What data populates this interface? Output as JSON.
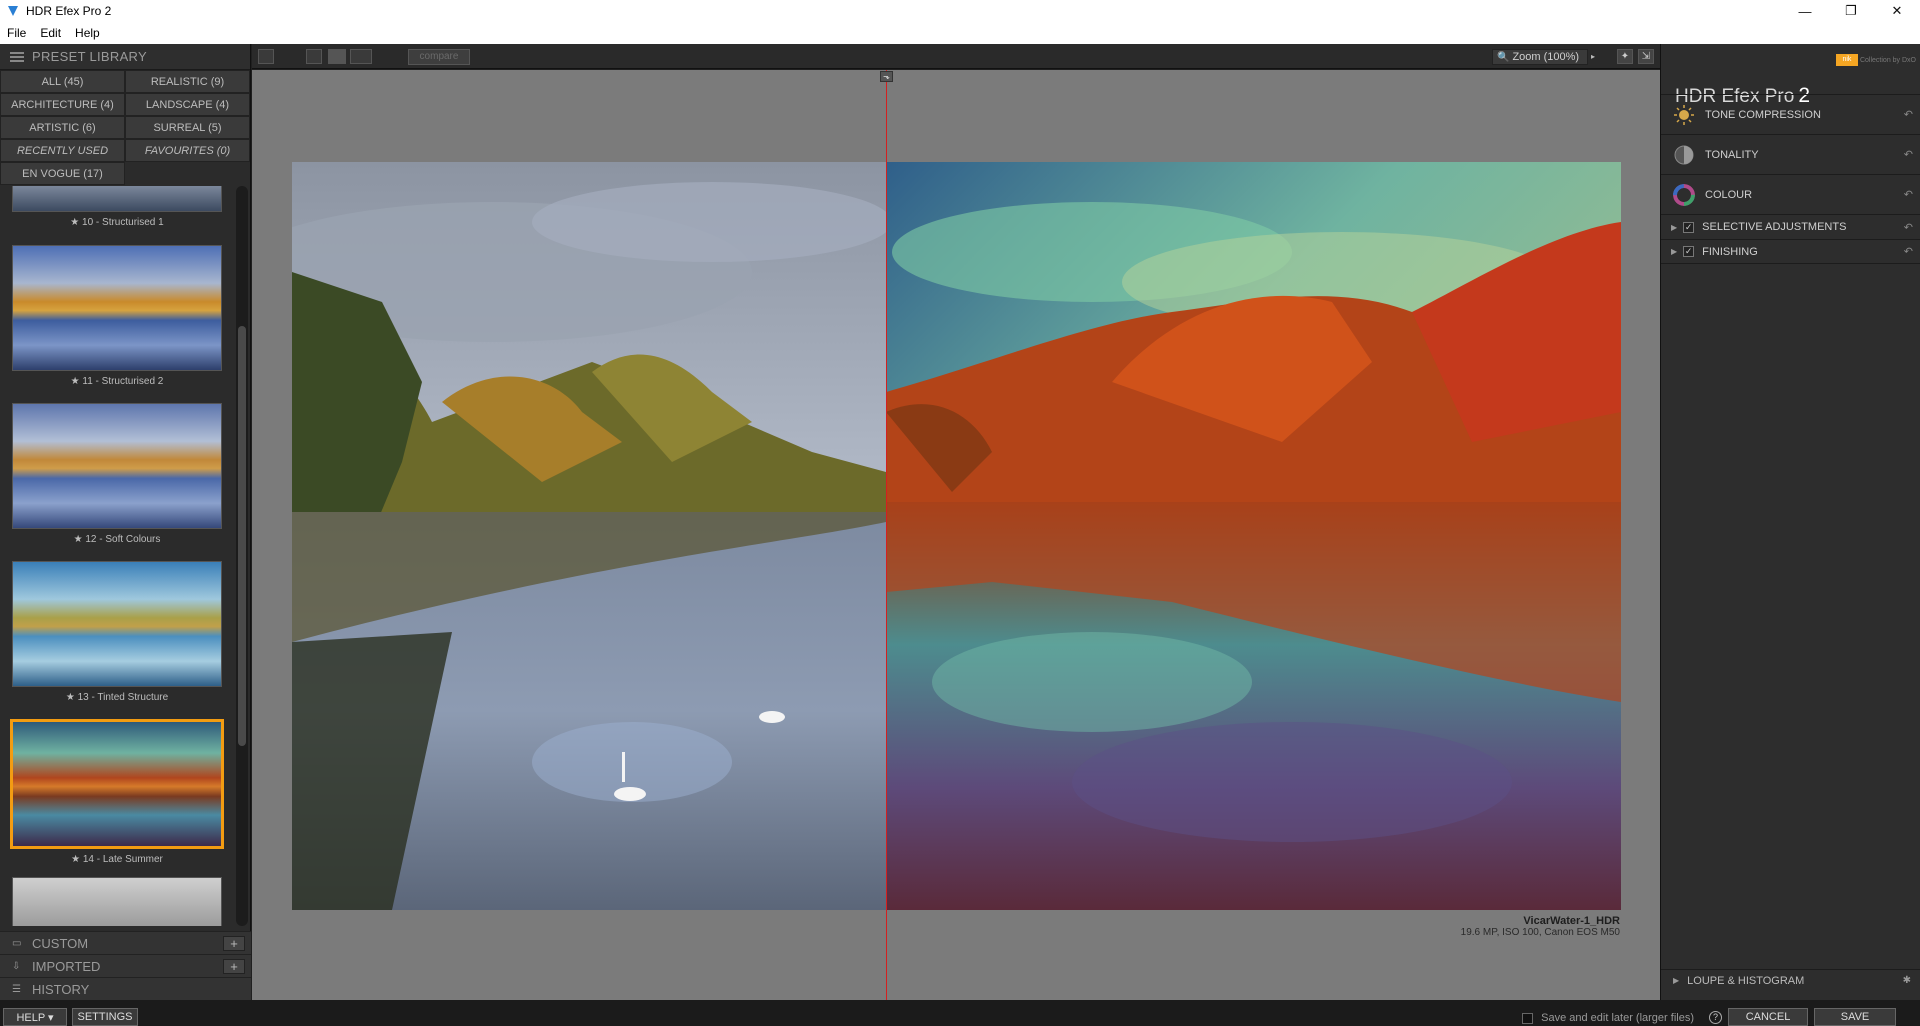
{
  "window": {
    "title": "HDR Efex Pro 2",
    "controls": [
      "—",
      "❐",
      "✕"
    ]
  },
  "menu": [
    "File",
    "Edit",
    "Help"
  ],
  "preset_library": {
    "header": "PRESET LIBRARY",
    "categories": [
      "ALL (45)",
      "REALISTIC (9)",
      "ARCHITECTURE (4)",
      "LANDSCAPE (4)",
      "ARTISTIC (6)",
      "SURREAL (5)",
      "RECENTLY USED",
      "FAVOURITES (0)",
      "EN VOGUE (17)"
    ],
    "presets": [
      {
        "label": "★ 10 - Structurised 1"
      },
      {
        "label": "★ 11 - Structurised 2"
      },
      {
        "label": "★ 12 - Soft Colours"
      },
      {
        "label": "★ 13 - Tinted Structure"
      },
      {
        "label": "★ 14 - Late Summer",
        "selected": true
      }
    ],
    "sections": [
      "CUSTOM",
      "IMPORTED",
      "HISTORY"
    ]
  },
  "toolbar": {
    "compare_label": "compare",
    "zoom_label": "Zoom (100%)"
  },
  "image_info": {
    "filename": "VicarWater-1_HDR",
    "meta": "19.6 MP, ISO 100, Canon EOS M50"
  },
  "right_panel": {
    "brand_text": "Collection by DxO",
    "app_title": "HDR Efex Pro",
    "app_version": "2",
    "sections": [
      "TONE COMPRESSION",
      "TONALITY",
      "COLOUR",
      "SELECTIVE ADJUSTMENTS",
      "FINISHING"
    ],
    "loupe_label": "LOUPE & HISTOGRAM"
  },
  "bottom": {
    "help_label": "HELP ▾",
    "settings_label": "SETTINGS",
    "save_later_label": "Save and edit later (larger files)",
    "cancel_label": "CANCEL",
    "save_label": "SAVE"
  },
  "colors": {
    "accent": "#f39c12",
    "split_line": "#d42020",
    "canvas_bg": "#7b7b7b"
  }
}
